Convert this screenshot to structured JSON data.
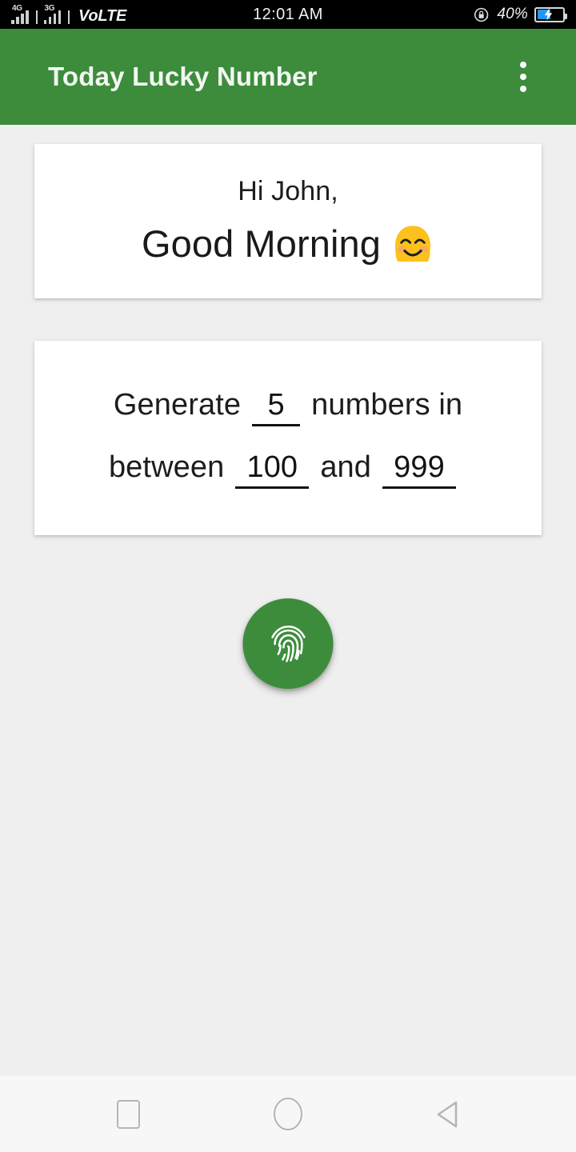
{
  "status_bar": {
    "network_labels": [
      "4G",
      "3G"
    ],
    "volte_prefix": "Vo",
    "volte_suffix": "LTE",
    "time": "12:01 AM",
    "battery_percent": "40%",
    "rotation_lock_icon": "rotation-lock-icon",
    "battery_icon": "battery-charging-icon",
    "battery_level": 40,
    "charging": true
  },
  "app_bar": {
    "title": "Today Lucky Number",
    "overflow_icon": "more-vertical-icon",
    "background_color": "#3c8c3c",
    "title_color": "#f2f7f2"
  },
  "greeting": {
    "salutation": "Hi John,",
    "message": "Good Morning",
    "emoji_name": "smiling-face-with-smiling-eyes-emoji"
  },
  "generator": {
    "text_before_count": "Generate",
    "count_value": "5",
    "text_after_count": "numbers in",
    "text_before_min": "between",
    "min_value": "100",
    "text_between": "and",
    "max_value": "999"
  },
  "fab": {
    "icon_name": "fingerprint-icon",
    "background_color": "#3c8c3c"
  },
  "nav_bar": {
    "recents_label": "recents-square-icon",
    "home_label": "home-circle-icon",
    "back_label": "back-triangle-icon"
  },
  "theme": {
    "page_background": "#efefef",
    "card_background": "#ffffff",
    "accent_green": "#3c8c3c",
    "text_primary": "#1d1d1d",
    "nav_background": "#f7f7f7"
  }
}
